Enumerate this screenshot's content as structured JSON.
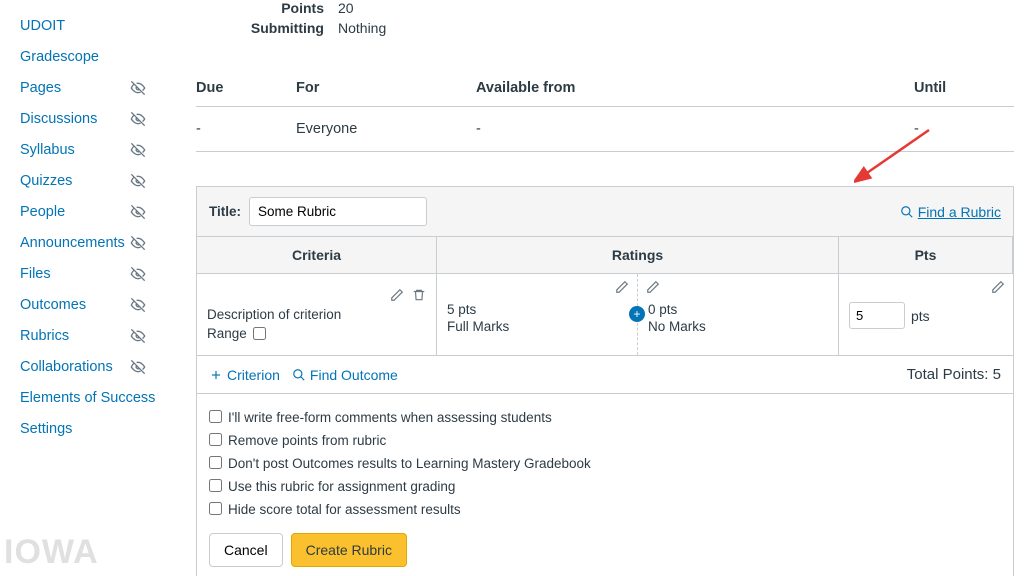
{
  "sidebar": {
    "items": [
      {
        "label": "UDOIT",
        "hidden": false
      },
      {
        "label": "Gradescope",
        "hidden": false
      },
      {
        "label": "Pages",
        "hidden": true
      },
      {
        "label": "Discussions",
        "hidden": true
      },
      {
        "label": "Syllabus",
        "hidden": true
      },
      {
        "label": "Quizzes",
        "hidden": true
      },
      {
        "label": "People",
        "hidden": true
      },
      {
        "label": "Announcements",
        "hidden": true
      },
      {
        "label": "Files",
        "hidden": true
      },
      {
        "label": "Outcomes",
        "hidden": true
      },
      {
        "label": "Rubrics",
        "hidden": true
      },
      {
        "label": "Collaborations",
        "hidden": true
      },
      {
        "label": "Elements of Success",
        "hidden": false
      },
      {
        "label": "Settings",
        "hidden": false
      }
    ]
  },
  "meta": {
    "points_label": "Points",
    "points_value": "20",
    "submitting_label": "Submitting",
    "submitting_value": "Nothing"
  },
  "availability": {
    "headers": {
      "due": "Due",
      "for": "For",
      "from": "Available from",
      "until": "Until"
    },
    "row": {
      "due": "-",
      "for": "Everyone",
      "from": "-",
      "until": "-"
    }
  },
  "rubric": {
    "title_label": "Title:",
    "title_value": "Some Rubric",
    "find_label": "Find a Rubric",
    "headers": {
      "criteria": "Criteria",
      "ratings": "Ratings",
      "pts": "Pts"
    },
    "criterion": {
      "description": "Description of criterion",
      "range_label": "Range"
    },
    "ratings": [
      {
        "pts": "5 pts",
        "label": "Full Marks"
      },
      {
        "pts": "0 pts",
        "label": "No Marks"
      }
    ],
    "points_value": "5",
    "points_unit": "pts",
    "add_criterion": "Criterion",
    "find_outcome": "Find Outcome",
    "total_label": "Total Points:",
    "total_value": "5",
    "checks": [
      "I'll write free-form comments when assessing students",
      "Remove points from rubric",
      "Don't post Outcomes results to Learning Mastery Gradebook",
      "Use this rubric for assignment grading",
      "Hide score total for assessment results"
    ],
    "cancel": "Cancel",
    "create": "Create Rubric"
  },
  "logo": "IOWA"
}
